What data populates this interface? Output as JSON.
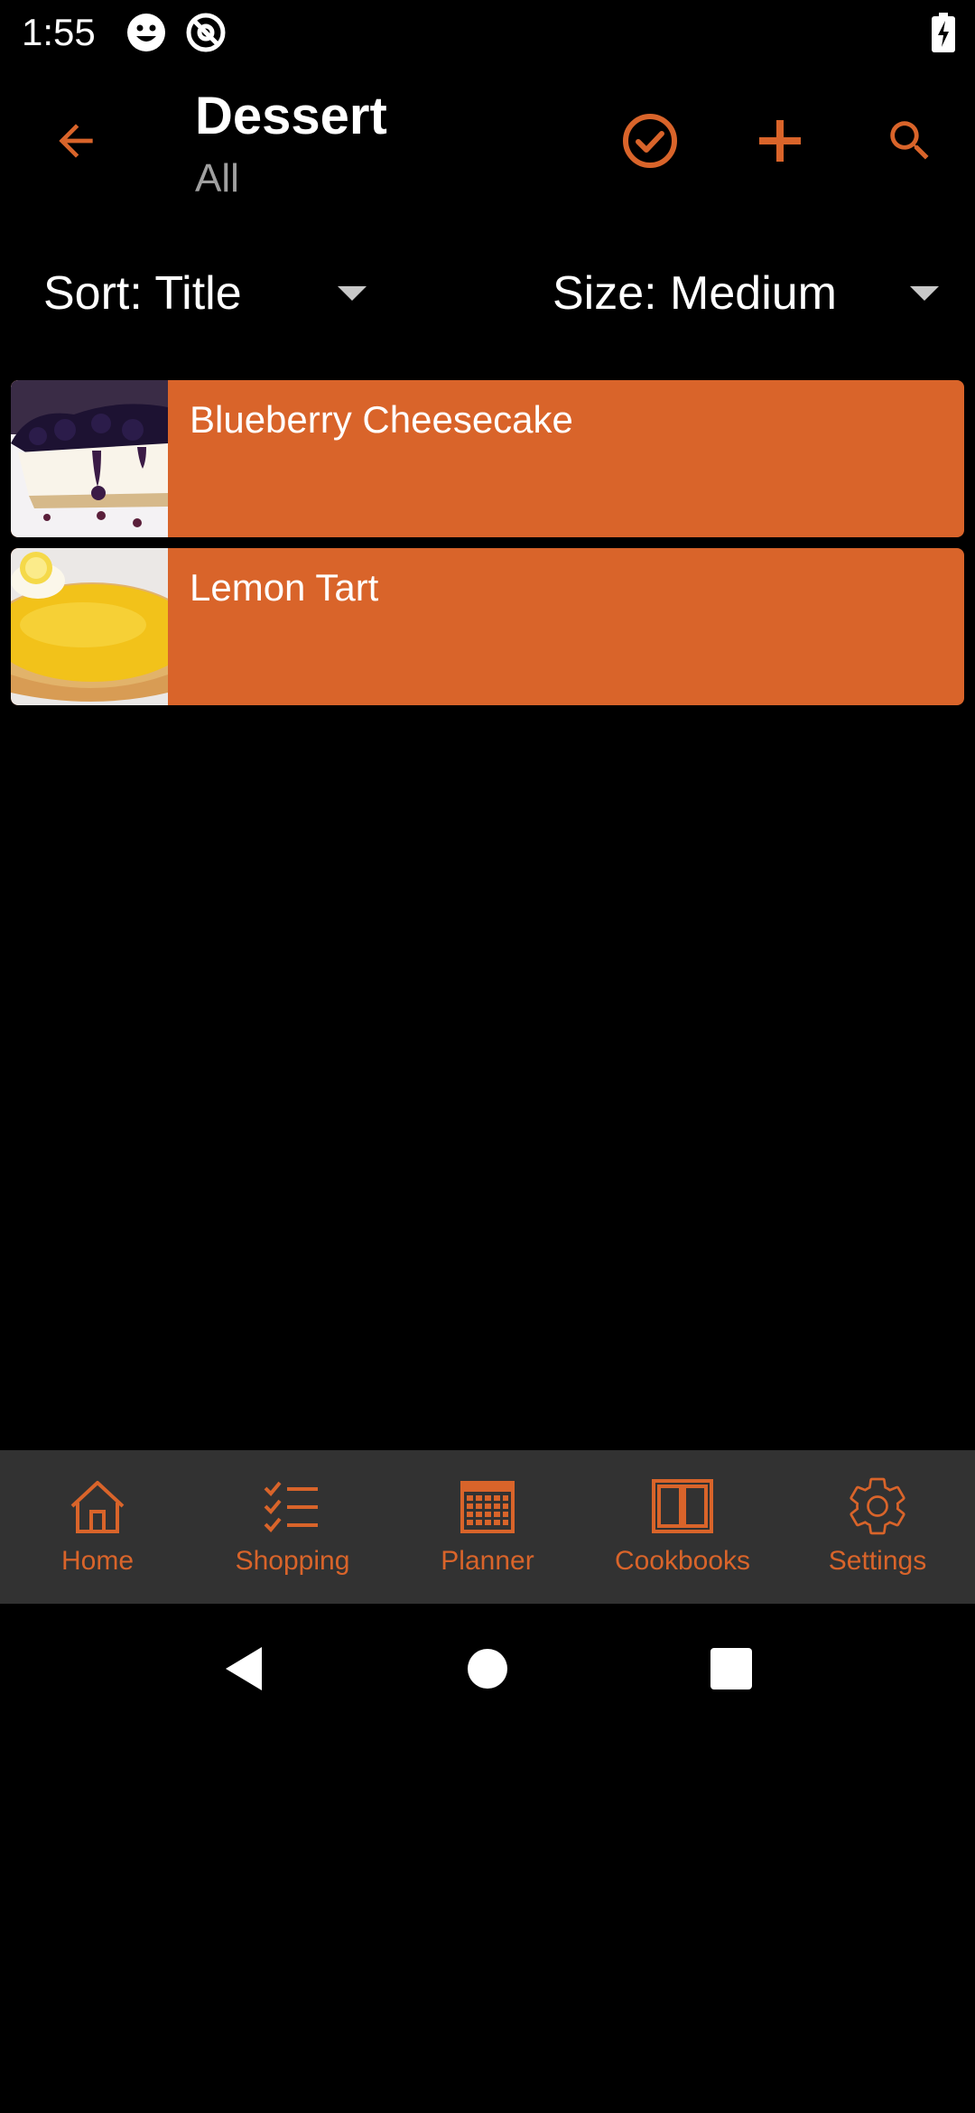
{
  "colors": {
    "accent": "#d9642a",
    "background": "#000000",
    "nav_background": "#323232",
    "subtitle": "#a0a0a0"
  },
  "status_bar": {
    "time": "1:55",
    "icons": [
      "smiley-icon",
      "at-sign-icon",
      "battery-charging-icon"
    ]
  },
  "toolbar": {
    "title": "Dessert",
    "subtitle": "All",
    "actions": [
      "back-arrow-icon",
      "check-circle-icon",
      "plus-icon",
      "search-icon"
    ]
  },
  "filters": {
    "sort_label": "Sort: Title",
    "size_label": "Size: Medium"
  },
  "recipes": [
    {
      "title": "Blueberry Cheesecake",
      "thumbnail": "cheesecake-photo"
    },
    {
      "title": "Lemon Tart",
      "thumbnail": "lemon-tart-photo"
    }
  ],
  "bottom_nav": {
    "items": [
      {
        "label": "Home",
        "icon": "home-icon"
      },
      {
        "label": "Shopping",
        "icon": "checklist-icon"
      },
      {
        "label": "Planner",
        "icon": "calendar-icon"
      },
      {
        "label": "Cookbooks",
        "icon": "book-icon"
      },
      {
        "label": "Settings",
        "icon": "gear-icon"
      }
    ]
  },
  "system_nav": {
    "buttons": [
      "back-triangle-icon",
      "home-circle-icon",
      "recents-square-icon"
    ]
  }
}
